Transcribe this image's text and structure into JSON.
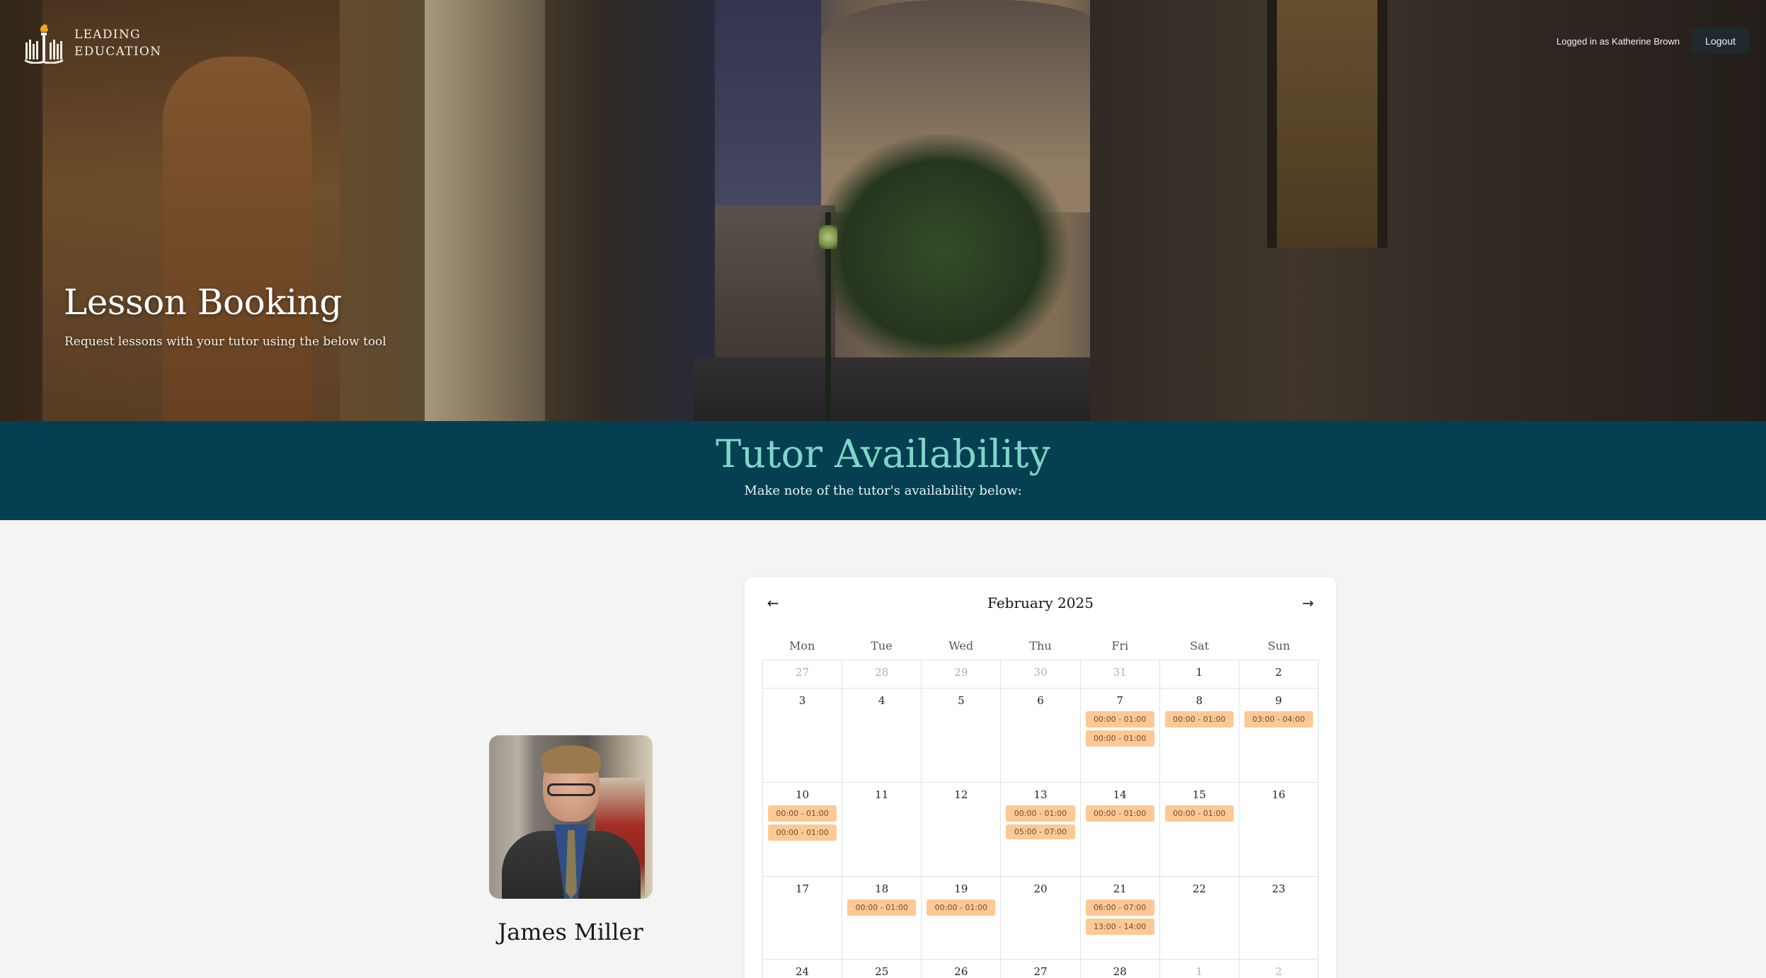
{
  "brand": {
    "line1": "LEADING",
    "line2": "EDUCATION"
  },
  "header": {
    "login_text": "Logged in as Katherine Brown",
    "logout_label": "Logout"
  },
  "hero": {
    "title": "Lesson Booking",
    "subtitle": "Request lessons with your tutor using the below tool"
  },
  "band": {
    "title": "Tutor Availability",
    "subtitle": "Make note of the tutor's availability below:"
  },
  "tutor": {
    "name": "James Miller"
  },
  "calendar": {
    "month_label": "February 2025",
    "prev_label": "←",
    "next_label": "→",
    "weekdays": [
      "Mon",
      "Tue",
      "Wed",
      "Thu",
      "Fri",
      "Sat",
      "Sun"
    ],
    "weeks": [
      [
        {
          "day": "27",
          "outside": true,
          "slots": []
        },
        {
          "day": "28",
          "outside": true,
          "slots": []
        },
        {
          "day": "29",
          "outside": true,
          "slots": []
        },
        {
          "day": "30",
          "outside": true,
          "slots": []
        },
        {
          "day": "31",
          "outside": true,
          "slots": []
        },
        {
          "day": "1",
          "outside": false,
          "slots": []
        },
        {
          "day": "2",
          "outside": false,
          "slots": []
        }
      ],
      [
        {
          "day": "3",
          "outside": false,
          "slots": []
        },
        {
          "day": "4",
          "outside": false,
          "slots": []
        },
        {
          "day": "5",
          "outside": false,
          "slots": []
        },
        {
          "day": "6",
          "outside": false,
          "slots": []
        },
        {
          "day": "7",
          "outside": false,
          "slots": [
            "00:00 - 01:00",
            "00:00 - 01:00"
          ]
        },
        {
          "day": "8",
          "outside": false,
          "slots": [
            "00:00 - 01:00"
          ]
        },
        {
          "day": "9",
          "outside": false,
          "slots": [
            "03:00 - 04:00"
          ]
        }
      ],
      [
        {
          "day": "10",
          "outside": false,
          "slots": [
            "00:00 - 01:00",
            "00:00 - 01:00"
          ]
        },
        {
          "day": "11",
          "outside": false,
          "slots": []
        },
        {
          "day": "12",
          "outside": false,
          "slots": []
        },
        {
          "day": "13",
          "outside": false,
          "slots": [
            "00:00 - 01:00",
            "05:00 - 07:00"
          ]
        },
        {
          "day": "14",
          "outside": false,
          "slots": [
            "00:00 - 01:00"
          ]
        },
        {
          "day": "15",
          "outside": false,
          "slots": [
            "00:00 - 01:00"
          ]
        },
        {
          "day": "16",
          "outside": false,
          "slots": []
        }
      ],
      [
        {
          "day": "17",
          "outside": false,
          "slots": []
        },
        {
          "day": "18",
          "outside": false,
          "slots": [
            "00:00 - 01:00"
          ]
        },
        {
          "day": "19",
          "outside": false,
          "slots": [
            "00:00 - 01:00"
          ]
        },
        {
          "day": "20",
          "outside": false,
          "slots": []
        },
        {
          "day": "21",
          "outside": false,
          "slots": [
            "06:00 - 07:00",
            "13:00 - 14:00"
          ]
        },
        {
          "day": "22",
          "outside": false,
          "slots": []
        },
        {
          "day": "23",
          "outside": false,
          "slots": []
        }
      ],
      [
        {
          "day": "24",
          "outside": false,
          "slots": []
        },
        {
          "day": "25",
          "outside": false,
          "slots": []
        },
        {
          "day": "26",
          "outside": false,
          "slots": []
        },
        {
          "day": "27",
          "outside": false,
          "slots": []
        },
        {
          "day": "28",
          "outside": false,
          "slots": []
        },
        {
          "day": "1",
          "outside": true,
          "slots": []
        },
        {
          "day": "2",
          "outside": true,
          "slots": []
        }
      ]
    ]
  },
  "colors": {
    "band_bg": "#053f52",
    "band_title": "#7fd6c8",
    "slot_bg": "#fcc995",
    "logout_bg": "#1e2a2d"
  }
}
